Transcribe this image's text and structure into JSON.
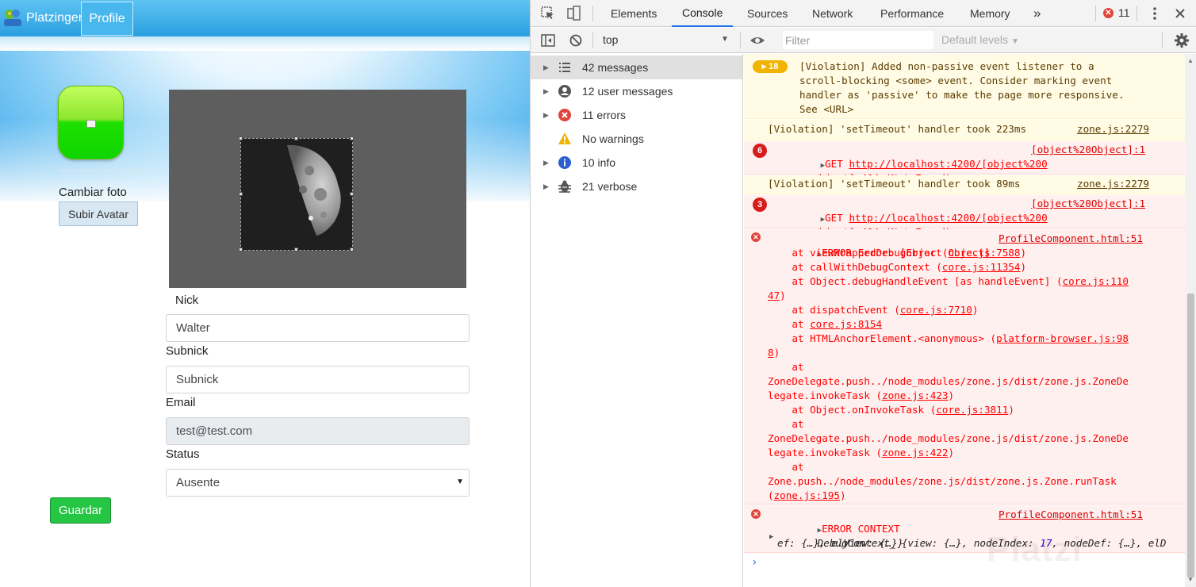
{
  "app": {
    "brand": "Platzinger",
    "nav_profile": "Profile",
    "cambiar_foto": "Cambiar foto",
    "subir_avatar": "Subir Avatar",
    "nick_label": "Nick",
    "nick_value": "Walter",
    "subnick_label": "Subnick",
    "subnick_value": "Subnick",
    "email_label": "Email",
    "email_value": "test@test.com",
    "status_label": "Status",
    "status_value": "Ausente",
    "guardar": "Guardar"
  },
  "devtools": {
    "tabs": [
      "Elements",
      "Console",
      "Sources",
      "Network",
      "Performance",
      "Memory"
    ],
    "more": "»",
    "error_count": "11",
    "context": "top",
    "filter_placeholder": "Filter",
    "levels": "Default levels",
    "sidebar": [
      {
        "label": "42 messages",
        "icon": "list-icon"
      },
      {
        "label": "12 user messages",
        "icon": "user-icon"
      },
      {
        "label": "11 errors",
        "icon": "error-icon"
      },
      {
        "label": "No warnings",
        "icon": "warning-icon"
      },
      {
        "label": "10 info",
        "icon": "info-icon"
      },
      {
        "label": "21 verbose",
        "icon": "bug-icon"
      }
    ],
    "messages": {
      "m1": {
        "badge": "18",
        "lines": [
          "[Violation] Added non-passive event listener to a",
          "scroll-blocking <some> event. Consider marking event",
          "handler as 'passive' to make the page more responsive.",
          "See <URL>"
        ]
      },
      "m2": {
        "text": "[Violation] 'setTimeout' handler took 223ms",
        "src": "zone.js:2279"
      },
      "m3": {
        "badge": "6",
        "get": "GET",
        "url": "http://localhost:4200/[object%200",
        "src": "[object%20Object]:1",
        "line2a": "bject]",
        "line2b": " 404 (Not Found)"
      },
      "m4": {
        "text": "[Violation] 'setTimeout' handler took 89ms",
        "src": "zone.js:2279"
      },
      "m5": {
        "badge": "3",
        "get": "GET",
        "url": "http://localhost:4200/[object%200",
        "src": "[object%20Object]:1",
        "line2a": "bject]",
        "line2b": " 404 (Not Found)"
      },
      "m6": {
        "head": "ERROR Error: [object Object]",
        "src": "ProfileComponent.html:51",
        "s1": [
          "    at viewWrappedDebugError (",
          "core.js:7588",
          ")"
        ],
        "s2": [
          "    at callWithDebugContext (",
          "core.js:11354",
          ")"
        ],
        "s3": [
          "    at Object.debugHandleEvent [as handleEvent] (",
          "core.js:110",
          ""
        ],
        "s3b": [
          "",
          "47",
          ")"
        ],
        "s4": [
          "    at dispatchEvent (",
          "core.js:7710",
          ")"
        ],
        "s5": [
          "    at ",
          "core.js:8154",
          ""
        ],
        "s6": [
          "    at HTMLAnchorElement.<anonymous> (",
          "platform-browser.js:98",
          ""
        ],
        "s6b": [
          "",
          "8",
          ")"
        ],
        "s7": "    at",
        "s8": "ZoneDelegate.push../node_modules/zone.js/dist/zone.js.ZoneDe",
        "s9": [
          "legate.invokeTask (",
          "zone.js:423",
          ")"
        ],
        "s10": [
          "    at Object.onInvokeTask (",
          "core.js:3811",
          ")"
        ],
        "s11": "    at",
        "s12": "ZoneDelegate.push../node_modules/zone.js/dist/zone.js.ZoneDe",
        "s13": [
          "legate.invokeTask (",
          "zone.js:422",
          ")"
        ],
        "s14": "    at",
        "s15": "Zone.push../node_modules/zone.js/dist/zone.js.Zone.runTask",
        "s16": [
          "(",
          "zone.js:195",
          ")"
        ]
      },
      "m7": {
        "head": "ERROR CONTEXT",
        "src": "ProfileComponent.html:51",
        "l1a": "DebugContext_",
        "l1b": " {view: {…}, nodeIndex: ",
        "l1c": "17",
        "l1d": ", nodeDef: {…}, elD",
        "l2": "ef: {…}, elView: {…}}"
      }
    },
    "watermark": "Platzi"
  }
}
